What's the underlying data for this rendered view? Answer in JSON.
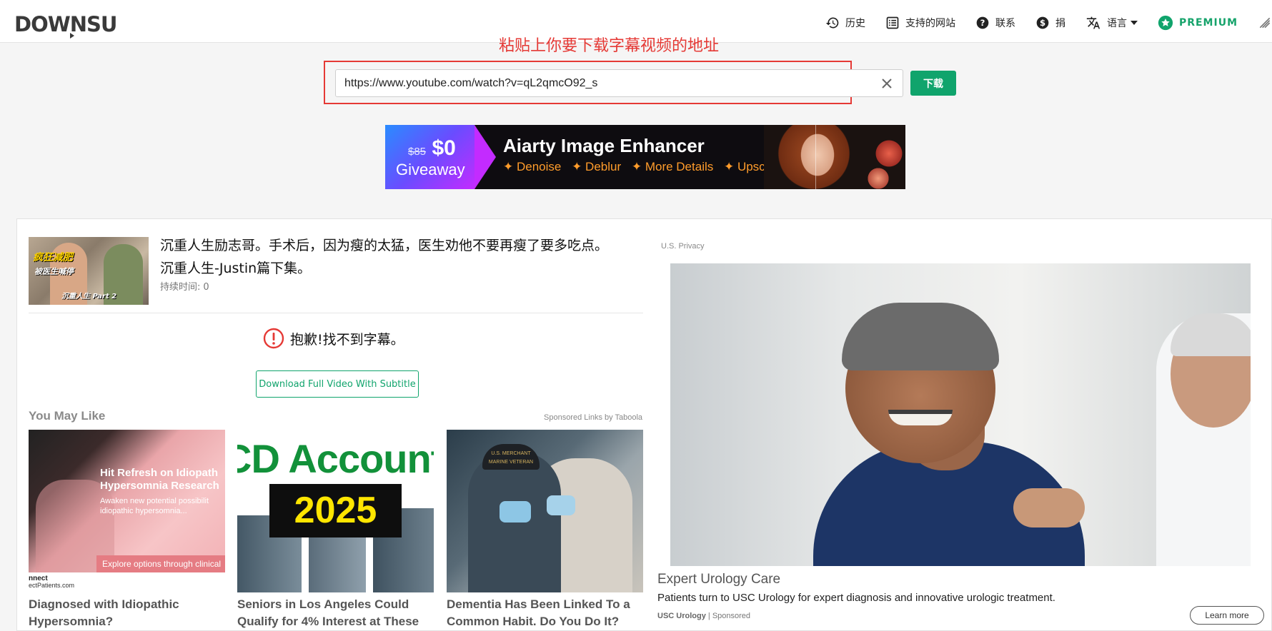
{
  "header": {
    "logo_text": "DOWNSUB",
    "nav": [
      {
        "label": "历史",
        "icon": "history-icon"
      },
      {
        "label": "支持的网站",
        "icon": "list-icon"
      },
      {
        "label": "联系",
        "icon": "question-icon"
      },
      {
        "label": "捐",
        "icon": "dollar-icon"
      },
      {
        "label": "语言",
        "icon": "translate-icon"
      },
      {
        "label": "PREMIUM",
        "icon": "star-icon"
      }
    ],
    "colors": {
      "accent": "#10a46c"
    }
  },
  "annotation": {
    "text": "粘贴上你要下载字幕视频的地址",
    "color": "#e53935"
  },
  "search": {
    "value": "https://www.youtube.com/watch?v=qL2qmcO92_s",
    "download_label": "下载"
  },
  "ad_banner": {
    "old_price": "$85",
    "new_price": "$0",
    "giveaway": "Giveaway",
    "title": "Aiarty Image Enhancer",
    "features": [
      "✦ Denoise",
      "✦ Deblur",
      "✦ More Details",
      "✦ Upscale"
    ]
  },
  "video": {
    "thumbnail_text": [
      "疯狂减肥",
      "被医生喊停",
      "沉重人生 Part 2"
    ],
    "title": "沉重人生励志哥。手术后，因为瘦的太猛，医生劝他不要再瘦了要多吃点。沉重人生-Justin篇下集。",
    "duration_label": "持续时间:",
    "duration_value": "0"
  },
  "result": {
    "error_text": "抱歉!找不到字幕。",
    "download_full_label": "Download Full Video With Subtitle"
  },
  "recommendations": {
    "title": "You May Like",
    "sponsored": "Sponsored Links by Taboola",
    "items": [
      {
        "image_heading": "Hit Refresh on Idiopath\nHypersomnia Research",
        "image_sub": "Awaken new potential possibilit\nidiopathic hypersomnia...",
        "image_bar": "Explore options through clinical",
        "logo_top": "nnect",
        "logo_bottom": "ectPatients.com",
        "title": "Diagnosed with Idiopathic Hypersomnia?"
      },
      {
        "image_word": "CD Account",
        "image_year": "2025",
        "title": "Seniors in Los Angeles Could Qualify for 4% Interest at These"
      },
      {
        "image_cap": "U.S. MERCHANT MARINE VETERAN",
        "title": "Dementia Has Been Linked To a Common Habit. Do You Do It?"
      }
    ]
  },
  "side_ad": {
    "privacy": "U.S. Privacy",
    "title": "Expert Urology Care",
    "description": "Patients turn to USC Urology for expert diagnosis and innovative urologic treatment.",
    "source": "USC Urology",
    "sponsored": "Sponsored",
    "cta": "Learn more"
  }
}
